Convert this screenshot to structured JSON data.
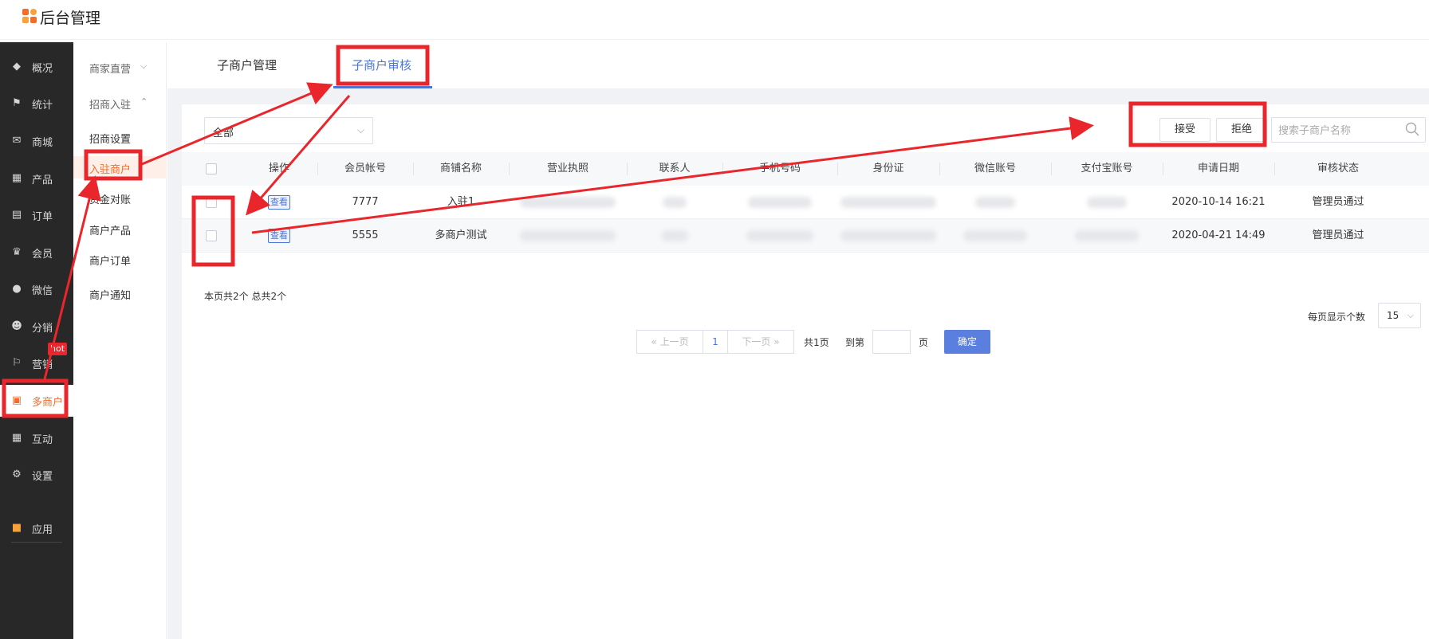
{
  "header": {
    "title": "后台管理"
  },
  "sidebar": {
    "items": [
      {
        "label": "概况",
        "icon": "layers-icon",
        "glyph": "◆"
      },
      {
        "label": "统计",
        "icon": "chart-icon",
        "glyph": "⚑"
      },
      {
        "label": "商城",
        "icon": "mail-icon",
        "glyph": "✉"
      },
      {
        "label": "产品",
        "icon": "grid-icon",
        "glyph": "▦"
      },
      {
        "label": "订单",
        "icon": "clipboard-icon",
        "glyph": "▤"
      },
      {
        "label": "会员",
        "icon": "crown-icon",
        "glyph": "♛"
      },
      {
        "label": "微信",
        "icon": "wechat-icon",
        "glyph": "●"
      },
      {
        "label": "分销",
        "icon": "users-icon",
        "glyph": "☻"
      },
      {
        "label": "营销",
        "icon": "flag-icon",
        "glyph": "⚐"
      },
      {
        "label": "多商户",
        "icon": "store-icon",
        "glyph": "▣"
      },
      {
        "label": "互动",
        "icon": "apps-icon",
        "glyph": "▦"
      },
      {
        "label": "设置",
        "icon": "gear-icon",
        "glyph": "⚙"
      },
      {
        "label": "应用",
        "icon": "app-grid-icon",
        "glyph": "▪"
      }
    ],
    "hot_badge": "hot"
  },
  "submenu": {
    "items": [
      {
        "label": "商家直营",
        "chevron": "⌵"
      },
      {
        "label": "招商入驻",
        "chevron": "⌃"
      },
      {
        "label": "招商设置"
      },
      {
        "label": "入驻商户"
      },
      {
        "label": "资金对账"
      },
      {
        "label": "商户产品"
      },
      {
        "label": "商户订单"
      },
      {
        "label": "商户通知"
      }
    ]
  },
  "tabs": [
    {
      "label": "子商户管理"
    },
    {
      "label": "子商户审核"
    }
  ],
  "toolbar": {
    "filter_value": "全部",
    "accept_label": "接受",
    "reject_label": "拒绝",
    "search_placeholder": "搜索子商户名称"
  },
  "table": {
    "columns": [
      "操作",
      "会员帐号",
      "商铺名称",
      "营业执照",
      "联系人",
      "手机号码",
      "身份证",
      "微信账号",
      "支付宝账号",
      "申请日期",
      "审核状态"
    ],
    "rows": [
      {
        "action": "查看",
        "account": "7777",
        "shop": "入驻1",
        "apply_date": "2020-10-14 16:21",
        "status": "管理员通过"
      },
      {
        "action": "查看",
        "account": "5555",
        "shop": "多商户测试",
        "apply_date": "2020-04-21 14:49",
        "status": "管理员通过"
      }
    ]
  },
  "footer": {
    "summary": "本页共2个  总共2个",
    "prev": "« 上一页",
    "current_page": "1",
    "next": "下一页 »",
    "total_pages": "共1页",
    "goto_label": "到第",
    "page_unit": "页",
    "confirm": "确定",
    "per_page_label": "每页显示个数",
    "per_page_value": "15"
  },
  "colors": {
    "accent_orange": "#f36d2a",
    "accent_blue": "#4a74d8",
    "annotation_red": "#e8262b",
    "sidebar_bg": "#282828"
  }
}
